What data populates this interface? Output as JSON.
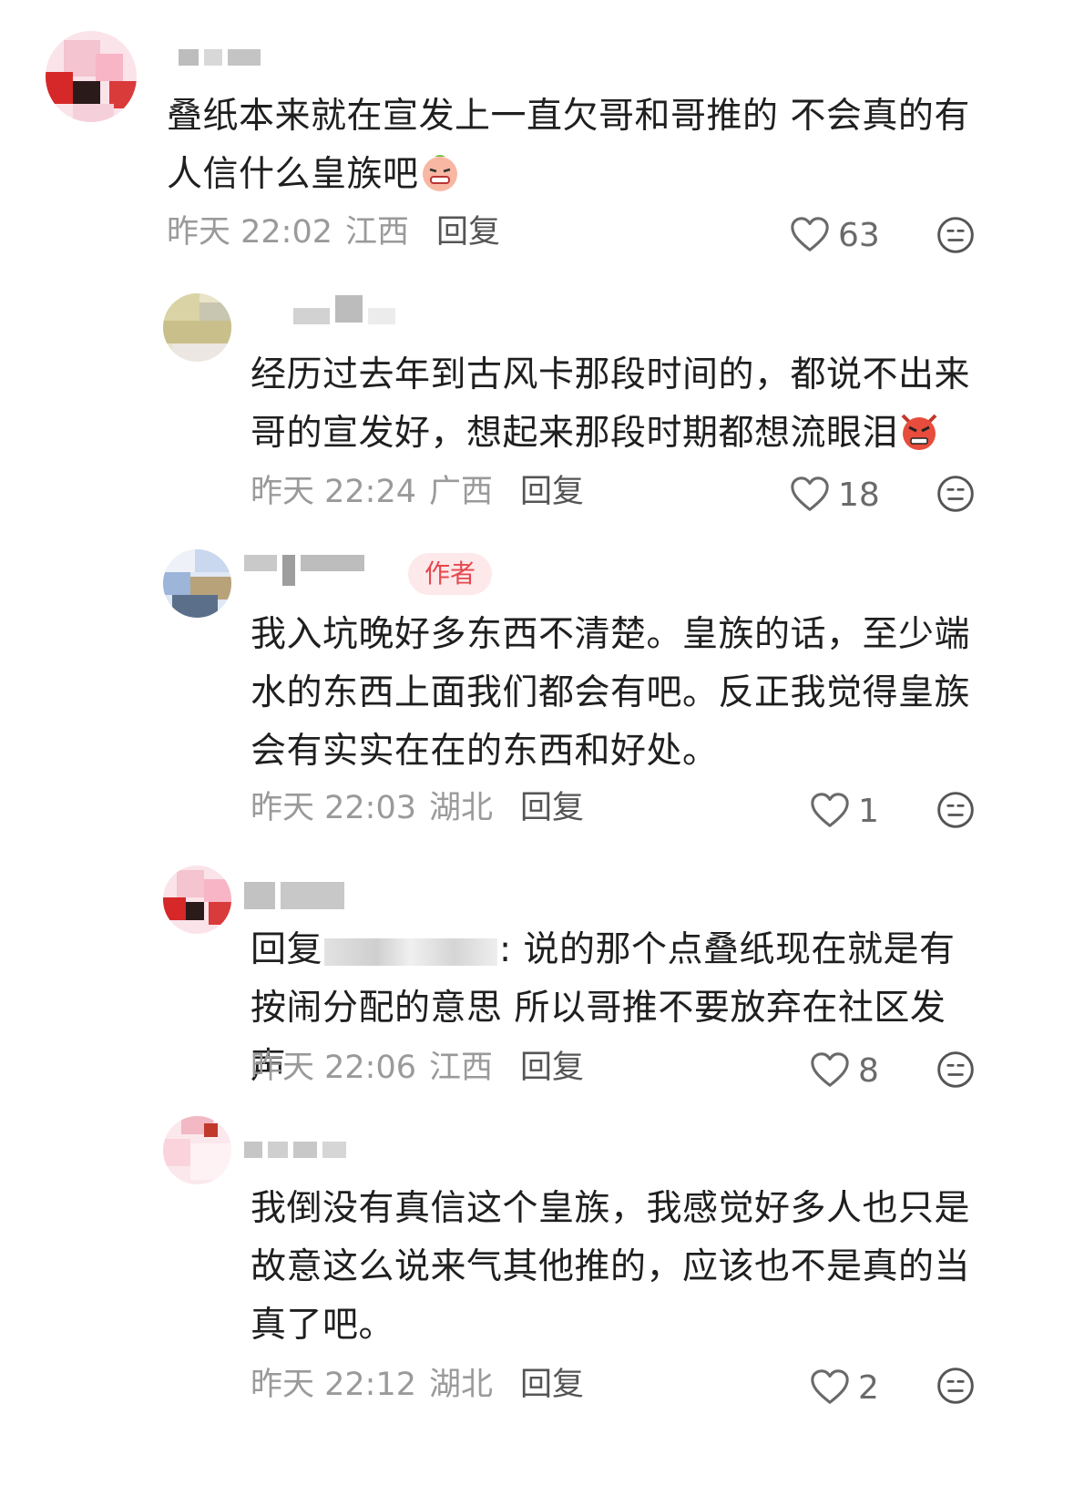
{
  "colors": {
    "badge_text": "#e5484d",
    "badge_bg": "#fde8ea",
    "meta": "#9a9a9a"
  },
  "comments": [
    {
      "text": "叠纸本来就在宣发上一直欠哥和哥推的 不会真的有人信什么皇族吧",
      "emoji": "grimace-emoji",
      "time": "昨天 22:02",
      "region": "江西",
      "reply_label": "回复",
      "likes": "63"
    },
    {
      "text": "经历过去年到古风卡那段时间的，都说不出来哥的宣发好，想起来那段时期都想流眼泪",
      "emoji": "angry-devil-emoji",
      "time": "昨天 22:24",
      "region": "广西",
      "reply_label": "回复",
      "likes": "18"
    },
    {
      "badge": "作者",
      "text": "我入坑晚好多东西不清楚。皇族的话，至少端水的东西上面我们都会有吧。反正我觉得皇族会有实实在在的东西和好处。",
      "time": "昨天 22:03",
      "region": "湖北",
      "reply_label": "回复",
      "likes": "1"
    },
    {
      "reply_prefix": "回复",
      "text_after_mention": ": 说的那个点叠纸现在就是有按闹分配的意思 所以哥推不要放弃在社区发声",
      "time": "昨天 22:06",
      "region": "江西",
      "reply_label": "回复",
      "likes": "8"
    },
    {
      "text": "我倒没有真信这个皇族，我感觉好多人也只是故意这么说来气其他推的，应该也不是真的当真了吧。",
      "time": "昨天 22:12",
      "region": "湖北",
      "reply_label": "回复",
      "likes": "2"
    }
  ]
}
